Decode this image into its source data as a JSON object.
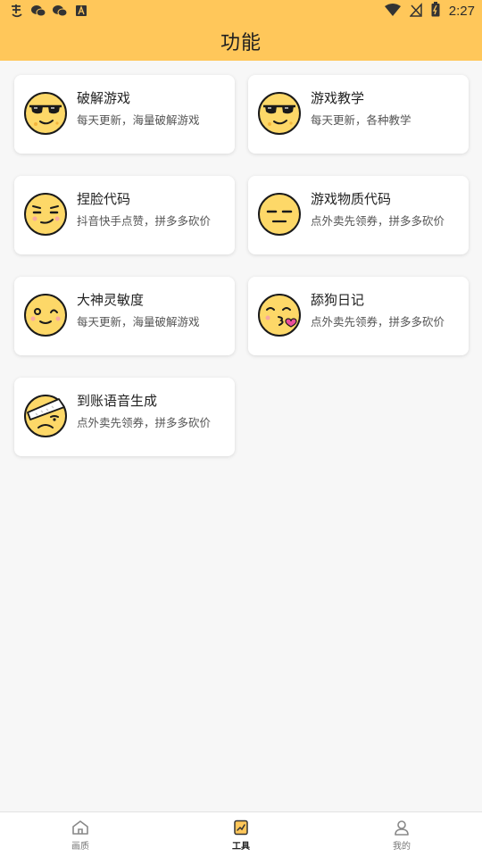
{
  "status_bar": {
    "time": "2:27",
    "left_icons": [
      "app-icon",
      "wechat-icon",
      "wechat-icon",
      "keyboard-icon"
    ],
    "right_icons": [
      "wifi-icon",
      "no-signal-icon",
      "battery-icon"
    ]
  },
  "header": {
    "title": "功能"
  },
  "tools": [
    {
      "title": "破解游戏",
      "subtitle": "每天更新，海量破解游戏",
      "icon": "sunglasses-face-icon"
    },
    {
      "title": "游戏教学",
      "subtitle": "每天更新，各种教学",
      "icon": "sunglasses-face-icon"
    },
    {
      "title": "捏脸代码",
      "subtitle": "抖音快手点赞，拼多多砍价",
      "icon": "smirk-face-icon"
    },
    {
      "title": "游戏物质代码",
      "subtitle": "点外卖先领券，拼多多砍价",
      "icon": "expressionless-face-icon"
    },
    {
      "title": "大神灵敏度",
      "subtitle": "每天更新，海量破解游戏",
      "icon": "wink-face-icon"
    },
    {
      "title": "舔狗日记",
      "subtitle": "点外卖先领券，拼多多砍价",
      "icon": "kissing-face-icon"
    },
    {
      "title": "到账语音生成",
      "subtitle": "点外卖先领券，拼多多砍价",
      "icon": "bandaged-face-icon"
    }
  ],
  "bottom_nav": {
    "items": [
      {
        "label": "画质",
        "icon": "home-icon",
        "active": false
      },
      {
        "label": "工具",
        "icon": "tools-icon",
        "active": true
      },
      {
        "label": "我的",
        "icon": "profile-icon",
        "active": false
      }
    ]
  },
  "colors": {
    "header_bg": "#ffc75a",
    "face_fill": "#fdd868",
    "face_outline": "#1a1a1a",
    "heart": "#ec4f9a"
  }
}
